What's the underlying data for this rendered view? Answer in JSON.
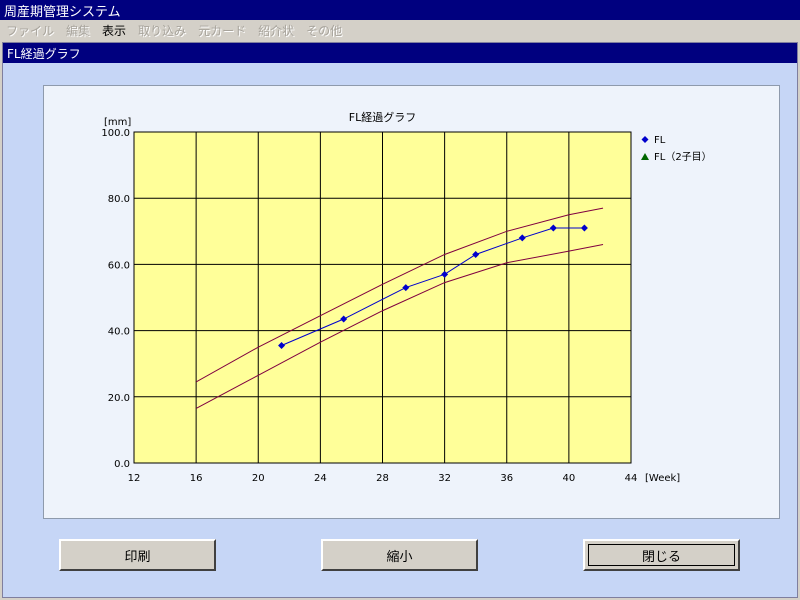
{
  "window": {
    "title": "周産期管理システム"
  },
  "menu": [
    {
      "label": "ファイル",
      "enabled": false
    },
    {
      "label": "編集",
      "enabled": false
    },
    {
      "label": "表示",
      "enabled": true
    },
    {
      "label": "取り込み",
      "enabled": false
    },
    {
      "label": "元カード",
      "enabled": false
    },
    {
      "label": "紹介状",
      "enabled": false
    },
    {
      "label": "その他",
      "enabled": false
    }
  ],
  "panel": {
    "title": "FL経過グラフ"
  },
  "buttons": {
    "print": "印刷",
    "shrink": "縮小",
    "close": "閉じる"
  },
  "colors": {
    "plot_bg": "#ffff99",
    "series_fl": "#0000cc",
    "series_fl2": "#006600",
    "band": "#800040"
  },
  "chart_data": {
    "type": "line",
    "title": "FL経過グラフ",
    "ylabel": "[mm]",
    "xlabel": "[Week]",
    "xlim": [
      12,
      44
    ],
    "ylim": [
      0,
      100
    ],
    "xticks": [
      12,
      16,
      20,
      24,
      28,
      32,
      36,
      40,
      44
    ],
    "yticks": [
      "0.0",
      "20.0",
      "40.0",
      "60.0",
      "80.0",
      "100.0"
    ],
    "grid": true,
    "legend_position": "right",
    "series": [
      {
        "name": "FL",
        "marker": "diamond",
        "x": [
          21.5,
          25.5,
          29.5,
          32,
          34,
          37,
          39,
          41
        ],
        "y": [
          35.5,
          43.5,
          53,
          57,
          63,
          68,
          71,
          71
        ]
      },
      {
        "name": "FL（2子目）",
        "marker": "triangle",
        "x": [],
        "y": []
      }
    ],
    "reference_bands": [
      {
        "x": [
          16,
          20,
          24,
          28,
          32,
          36,
          40,
          42.2
        ],
        "y": [
          24.5,
          35,
          44.5,
          54,
          63,
          70,
          75,
          77
        ]
      },
      {
        "x": [
          16,
          20,
          24,
          28,
          32,
          36,
          40,
          42.2
        ],
        "y": [
          16.5,
          26.5,
          36.5,
          46,
          54.5,
          60.5,
          64,
          66
        ]
      }
    ]
  }
}
